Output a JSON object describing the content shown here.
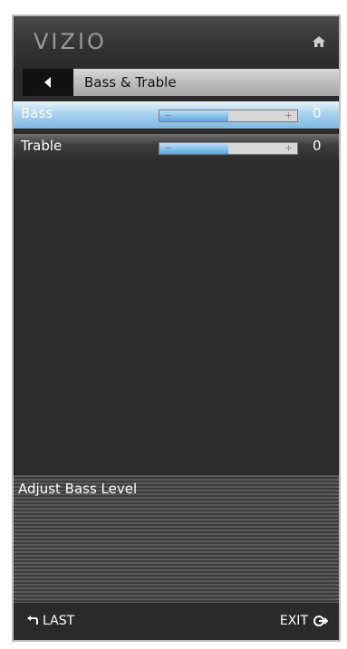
{
  "header": {
    "brand": "VIZIO",
    "home_icon": "home-icon"
  },
  "breadcrumb": {
    "back_icon": "back-arrow-icon",
    "title": "Bass & Trable"
  },
  "settings": [
    {
      "label": "Bass",
      "value": "0",
      "level_fraction": 0.5
    },
    {
      "label": "Trable",
      "value": "0",
      "level_fraction": 0.5
    }
  ],
  "help": {
    "text": "Adjust Bass Level"
  },
  "footer": {
    "last_label": "LAST",
    "exit_label": "EXIT"
  },
  "colors": {
    "selected_row": "#7fb8e2",
    "slider_fill": "#5aa7e0",
    "panel_bg": "#2c2c2c"
  }
}
